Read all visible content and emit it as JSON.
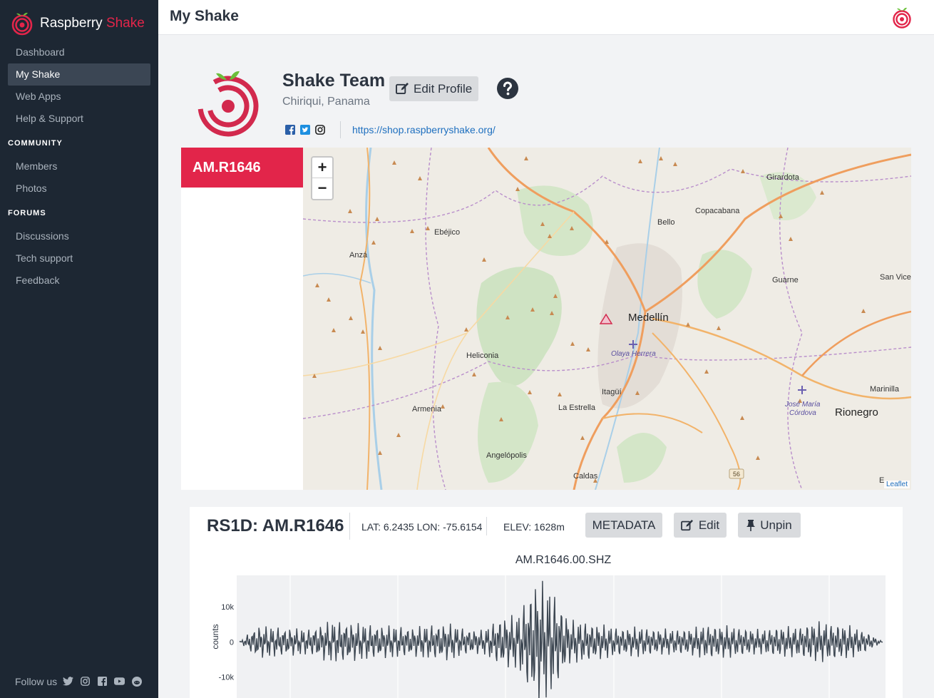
{
  "sidebar": {
    "brand": {
      "name_main": "Raspberry",
      "name_accent": "Shake"
    },
    "nav_top": [
      {
        "label": "Dashboard",
        "active": false
      },
      {
        "label": "My Shake",
        "active": true
      },
      {
        "label": "Web Apps",
        "active": false
      },
      {
        "label": "Help & Support",
        "active": false
      }
    ],
    "community_title": "COMMUNITY",
    "nav_community": [
      {
        "label": "Members"
      },
      {
        "label": "Photos"
      }
    ],
    "forums_title": "FORUMS",
    "nav_forums": [
      {
        "label": "Discussions"
      },
      {
        "label": "Tech support"
      },
      {
        "label": "Feedback"
      }
    ],
    "follow_label": "Follow us",
    "follow_icons": [
      "twitter-icon",
      "instagram-icon",
      "facebook-icon",
      "youtube-icon",
      "reddit-icon"
    ]
  },
  "header": {
    "title": "My Shake"
  },
  "profile": {
    "name": "Shake Team",
    "location": "Chiriqui, Panama",
    "edit_label": "Edit Profile",
    "link": "https://shop.raspberryshake.org/",
    "social_icons": [
      "facebook-icon",
      "twitter-icon",
      "instagram-icon"
    ]
  },
  "station": {
    "tab_label": "AM.R1646"
  },
  "map": {
    "zoom_in": "+",
    "zoom_out": "−",
    "attribution": "Leaflet",
    "road_badge": "56",
    "labels": {
      "medellin": "Medellín",
      "rionegro": "Rionegro",
      "girardota": "Girardota",
      "copacabana": "Copacabana",
      "bello": "Bello",
      "ebejico": "Ebéjico",
      "anza": "Anzá",
      "guarne": "Guarne",
      "san_vice": "San Vice",
      "heliconia": "Heliconia",
      "olaya": "Olaya Herrera",
      "itagui": "Itagüí",
      "la_estrella": "La Estrella",
      "armenia": "Armenia",
      "marinilla": "Marinilla",
      "jose_maria": "José María",
      "cordova": "Córdova",
      "angelopolis": "Angelópolis",
      "caldas": "Caldas",
      "e_cut": "E"
    }
  },
  "detail": {
    "title": "RS1D: AM.R1646",
    "coords": "LAT: 6.2435 LON: -75.6154",
    "elev": "ELEV: 1628m",
    "metadata_label": "METADATA",
    "edit_label": "Edit",
    "unpin_label": "Unpin"
  },
  "colors": {
    "accent": "#e2254a",
    "sidebar_bg": "#1d2733",
    "link": "#1e6fbf",
    "trace": "#3d4752"
  },
  "chart_data": {
    "type": "line",
    "title": "AM.R1646.00.SHZ",
    "ylabel": "counts",
    "xlabel": "",
    "y_ticks": [
      "10k",
      "0",
      "-10k"
    ],
    "ylim": [
      -16000,
      19000
    ],
    "grid": true,
    "series": [
      {
        "values": [
          0,
          5000,
          -4500,
          4200,
          -3800,
          6000,
          -6200,
          5500,
          -5000,
          4800,
          -4400,
          5200,
          -5600,
          4000,
          -3500,
          7500,
          -8000,
          19000,
          -16000,
          6500,
          -6000,
          5000,
          -4200,
          4500,
          -3900,
          3800,
          -4100,
          5200,
          -4800,
          4300,
          -3600,
          4700,
          -4400,
          6000,
          -5800,
          5000,
          -3300,
          0
        ]
      }
    ]
  }
}
